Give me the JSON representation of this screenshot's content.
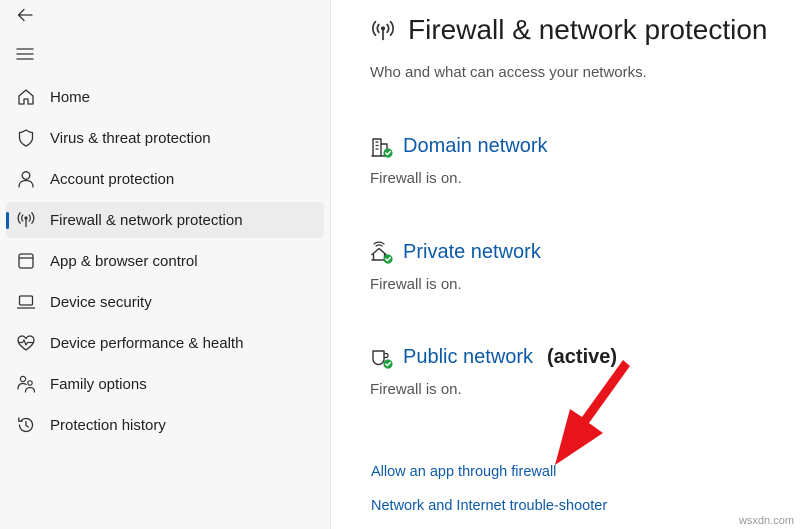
{
  "sidebar": {
    "items": [
      {
        "label": "Home",
        "icon": "home-icon",
        "active": false
      },
      {
        "label": "Virus & threat protection",
        "icon": "shield-icon",
        "active": false
      },
      {
        "label": "Account protection",
        "icon": "person-icon",
        "active": false
      },
      {
        "label": "Firewall & network protection",
        "icon": "antenna-icon",
        "active": true
      },
      {
        "label": "App & browser control",
        "icon": "browser-window-icon",
        "active": false
      },
      {
        "label": "Device security",
        "icon": "laptop-icon",
        "active": false
      },
      {
        "label": "Device performance & health",
        "icon": "heart-pulse-icon",
        "active": false
      },
      {
        "label": "Family options",
        "icon": "family-icon",
        "active": false
      },
      {
        "label": "Protection history",
        "icon": "history-icon",
        "active": false
      }
    ]
  },
  "main": {
    "title": "Firewall & network protection",
    "subtitle": "Who and what can access your networks.",
    "networks": [
      {
        "name": "Domain network",
        "status": "Firewall is on.",
        "icon": "domain-network-icon"
      },
      {
        "name": "Private network",
        "status": "Firewall is on.",
        "icon": "private-network-icon"
      },
      {
        "name": "Public network",
        "active_label": "(active)",
        "status": "Firewall is on.",
        "icon": "public-network-icon"
      }
    ],
    "links": [
      {
        "label": "Allow an app through firewall"
      },
      {
        "label": "Network and Internet trouble-shooter"
      }
    ]
  },
  "watermark": "wsxdn.com",
  "colors": {
    "accent": "#0a5fb4",
    "link": "#0d5aa7",
    "status_ok": "#1e9e3e",
    "arrow": "#e8141c"
  }
}
